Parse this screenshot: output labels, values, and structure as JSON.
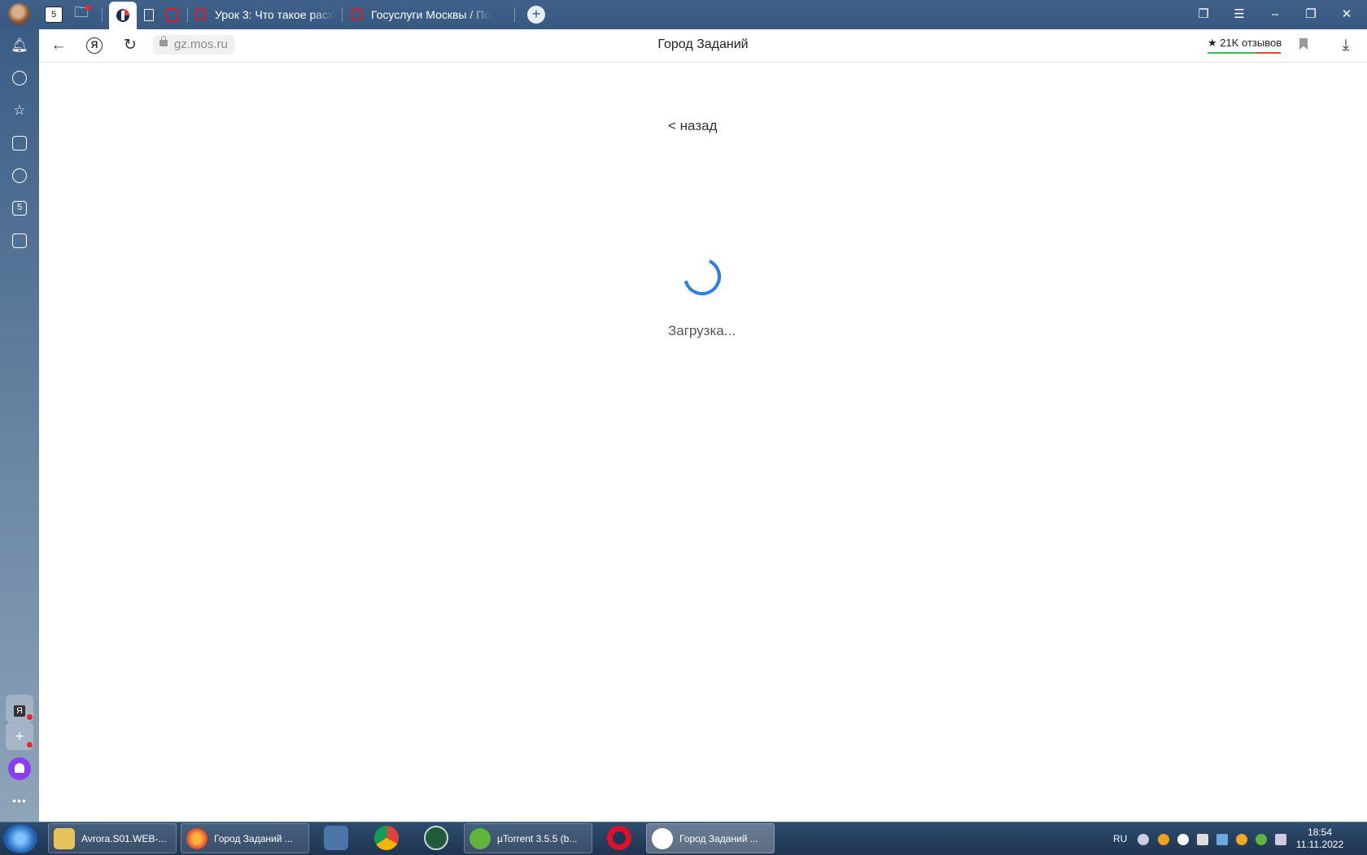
{
  "tabs": {
    "items": [
      {
        "label": "Урок 3: Что такое расходы"
      },
      {
        "label": "Госуслуги Москвы / Портал"
      }
    ]
  },
  "pinned": {
    "five_label": "5"
  },
  "sidebar": {
    "ya_label": "Я",
    "s_label": "5"
  },
  "addressbar": {
    "url": "gz.mos.ru",
    "page_title": "Город Заданий",
    "reviews": "★ 21K отзывов"
  },
  "page": {
    "back_link": "< назад",
    "loading_text": "Загрузка..."
  },
  "taskbar": {
    "items": [
      {
        "label": "Avrora.S01.WEB-..."
      },
      {
        "label": "Город Заданий ..."
      },
      {
        "label": "µTorrent 3.5.5  (b..."
      },
      {
        "label": "Город Заданий ..."
      }
    ],
    "lang": "RU",
    "time": "18:54",
    "date": "11.11.2022"
  },
  "colors": {
    "accent": "#2d7ee8",
    "tabbar": "#3f6088",
    "taskbar": "#1f3551"
  }
}
